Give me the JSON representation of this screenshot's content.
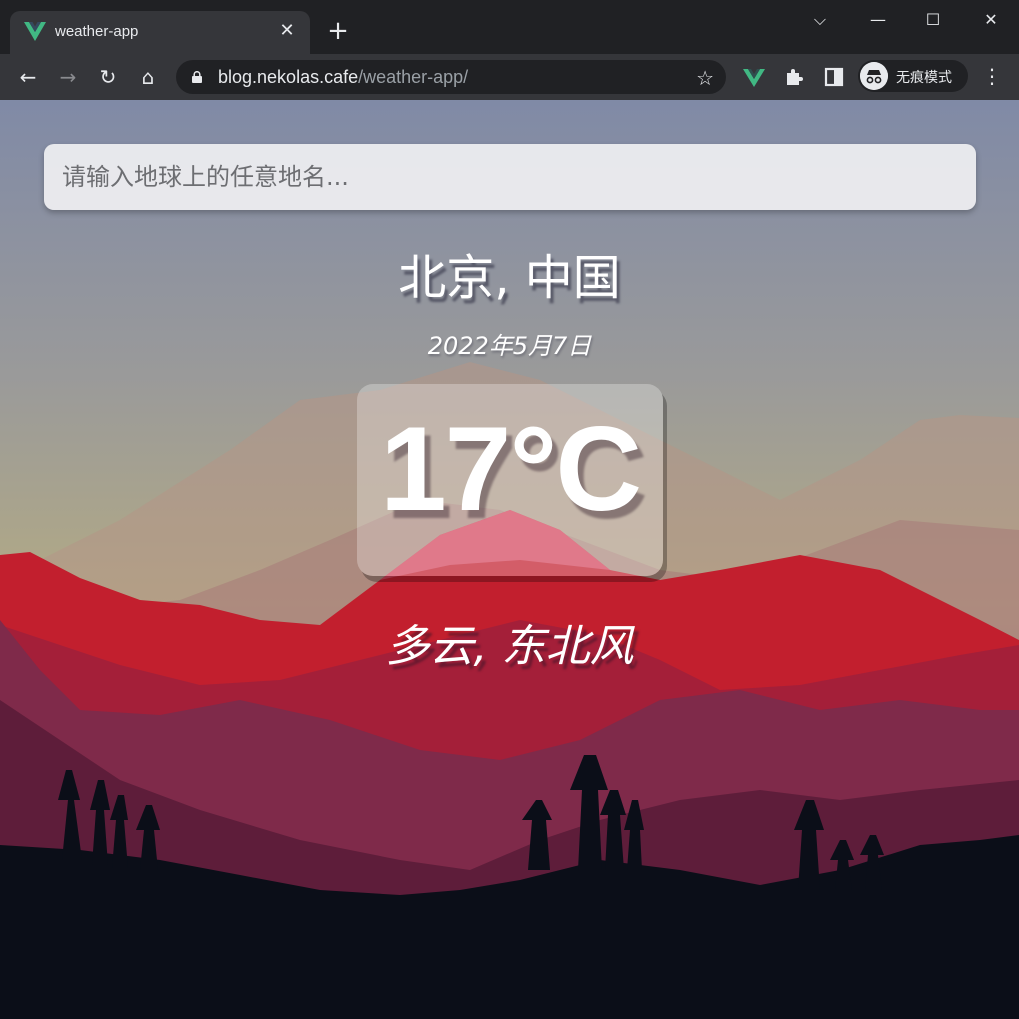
{
  "browser": {
    "tab": {
      "title": "weather-app",
      "close": "✕"
    },
    "new_tab": "+",
    "window_controls": {
      "tab_search": "⌵",
      "minimize": "—",
      "maximize": "☐",
      "close": "✕"
    },
    "nav": {
      "back": "←",
      "forward": "→",
      "reload": "↻",
      "home": "⌂"
    },
    "url": {
      "host": "blog.nekolas.cafe",
      "path": "/weather-app/"
    },
    "bookmark_star": "☆",
    "profile_label": "无痕模式",
    "menu": "⋮"
  },
  "app": {
    "search": {
      "placeholder": "请输入地球上的任意地名..."
    },
    "location": "北京, 中国",
    "date": "2022年5月7日",
    "temperature": "17°C",
    "weather": "多云, 东北风"
  },
  "colors": {
    "accent_vue": "#41b883",
    "sky_top": "#808aa6",
    "sky_mid": "#b3aa84",
    "mountain_red": "#c21f2e",
    "ground": "#0b0e18"
  }
}
